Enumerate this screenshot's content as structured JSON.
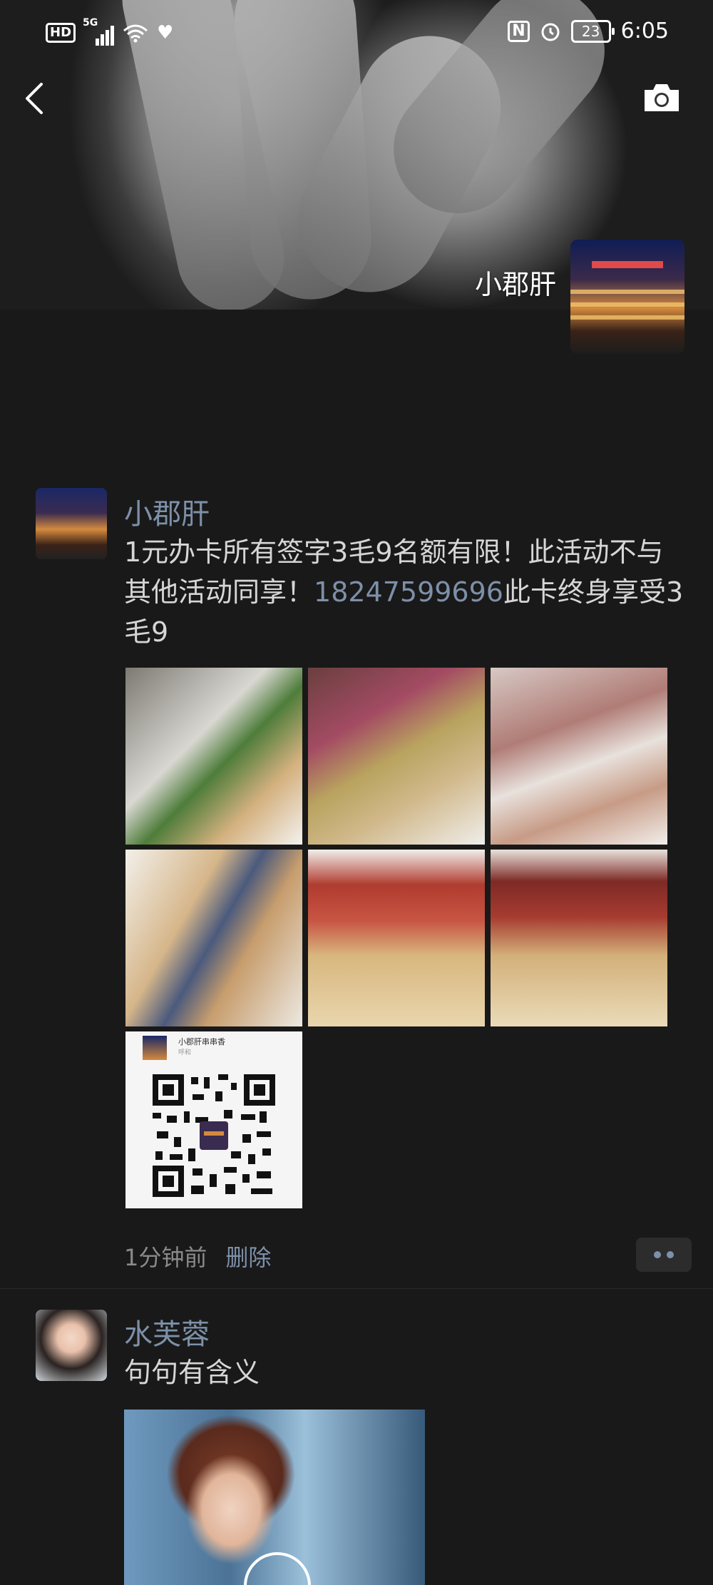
{
  "status_bar": {
    "hd": "HD",
    "network": "5G",
    "battery": "23",
    "time": "6:05"
  },
  "cover": {
    "owner_name": "小郡肝"
  },
  "posts": [
    {
      "author": "小郡肝",
      "text_before_phone": "1元办卡所有签字3毛9名额有限！此活动不与其他活动同享！",
      "phone": "18247599696",
      "text_after_phone": "此卡终身享受3毛9",
      "qr_title": "小郡肝串串香",
      "qr_subtitle": "呼和",
      "time": "1分钟前",
      "delete_label": "删除"
    },
    {
      "author": "水芙蓉",
      "text": "句句有含义"
    }
  ],
  "icons": {
    "back": "back-arrow-icon",
    "camera": "camera-icon",
    "more": "more-dots-icon"
  },
  "colors": {
    "background": "#191919",
    "link": "#7d90a9",
    "text": "#d6d6d6",
    "meta": "#8a8a8a"
  }
}
